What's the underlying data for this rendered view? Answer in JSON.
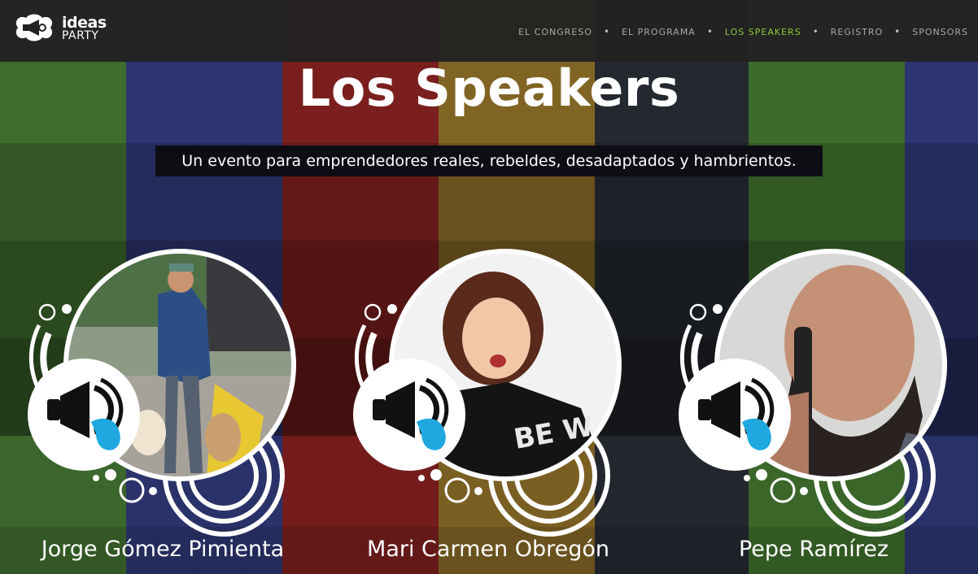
{
  "brand": {
    "line1": "ideas",
    "line2": "PARTY"
  },
  "nav": {
    "items": [
      {
        "label": "EL CONGRESO",
        "active": false
      },
      {
        "label": "EL PROGRAMA",
        "active": false
      },
      {
        "label": "LOS SPEAKERS",
        "active": true
      },
      {
        "label": "REGISTRO",
        "active": false
      },
      {
        "label": "SPONSORS",
        "active": false
      }
    ],
    "separator": "•",
    "active_color": "#8ec63f"
  },
  "hero": {
    "title": "Los Speakers",
    "tagline": "Un evento para emprendedores reales, rebeldes, desadaptados y hambrientos."
  },
  "speakers": [
    {
      "name": "Jorge Gómez Pimienta"
    },
    {
      "name": "Mari Carmen Obregón"
    },
    {
      "name": "Pepe Ramírez"
    }
  ],
  "colors": {
    "accent_blue": "#1fa8e0",
    "stripes": [
      "#3e6b2e",
      "#2c3570",
      "#7a1e1e",
      "#806424",
      "#24282f",
      "#3d6b2c",
      "#2c3570"
    ]
  }
}
